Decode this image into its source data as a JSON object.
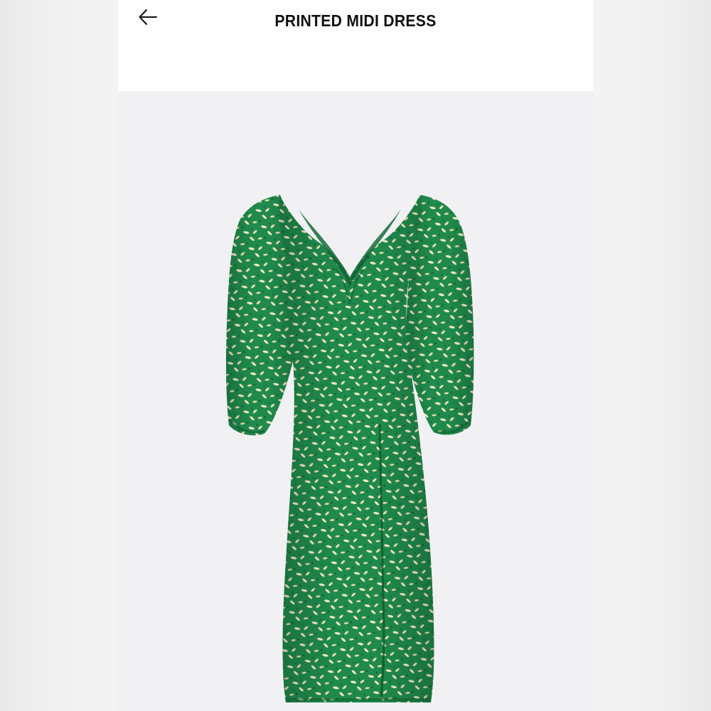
{
  "header": {
    "back_icon": "arrow-left-icon",
    "title": "PRINTED MIDI DRESS"
  },
  "product_image": {
    "subject": "printed-dress-photo",
    "colors": {
      "fabric": "#1f8a4c",
      "fabric_dark": "#176b3a",
      "print": "#f3e9c6",
      "background": "#f1f1f3"
    }
  }
}
